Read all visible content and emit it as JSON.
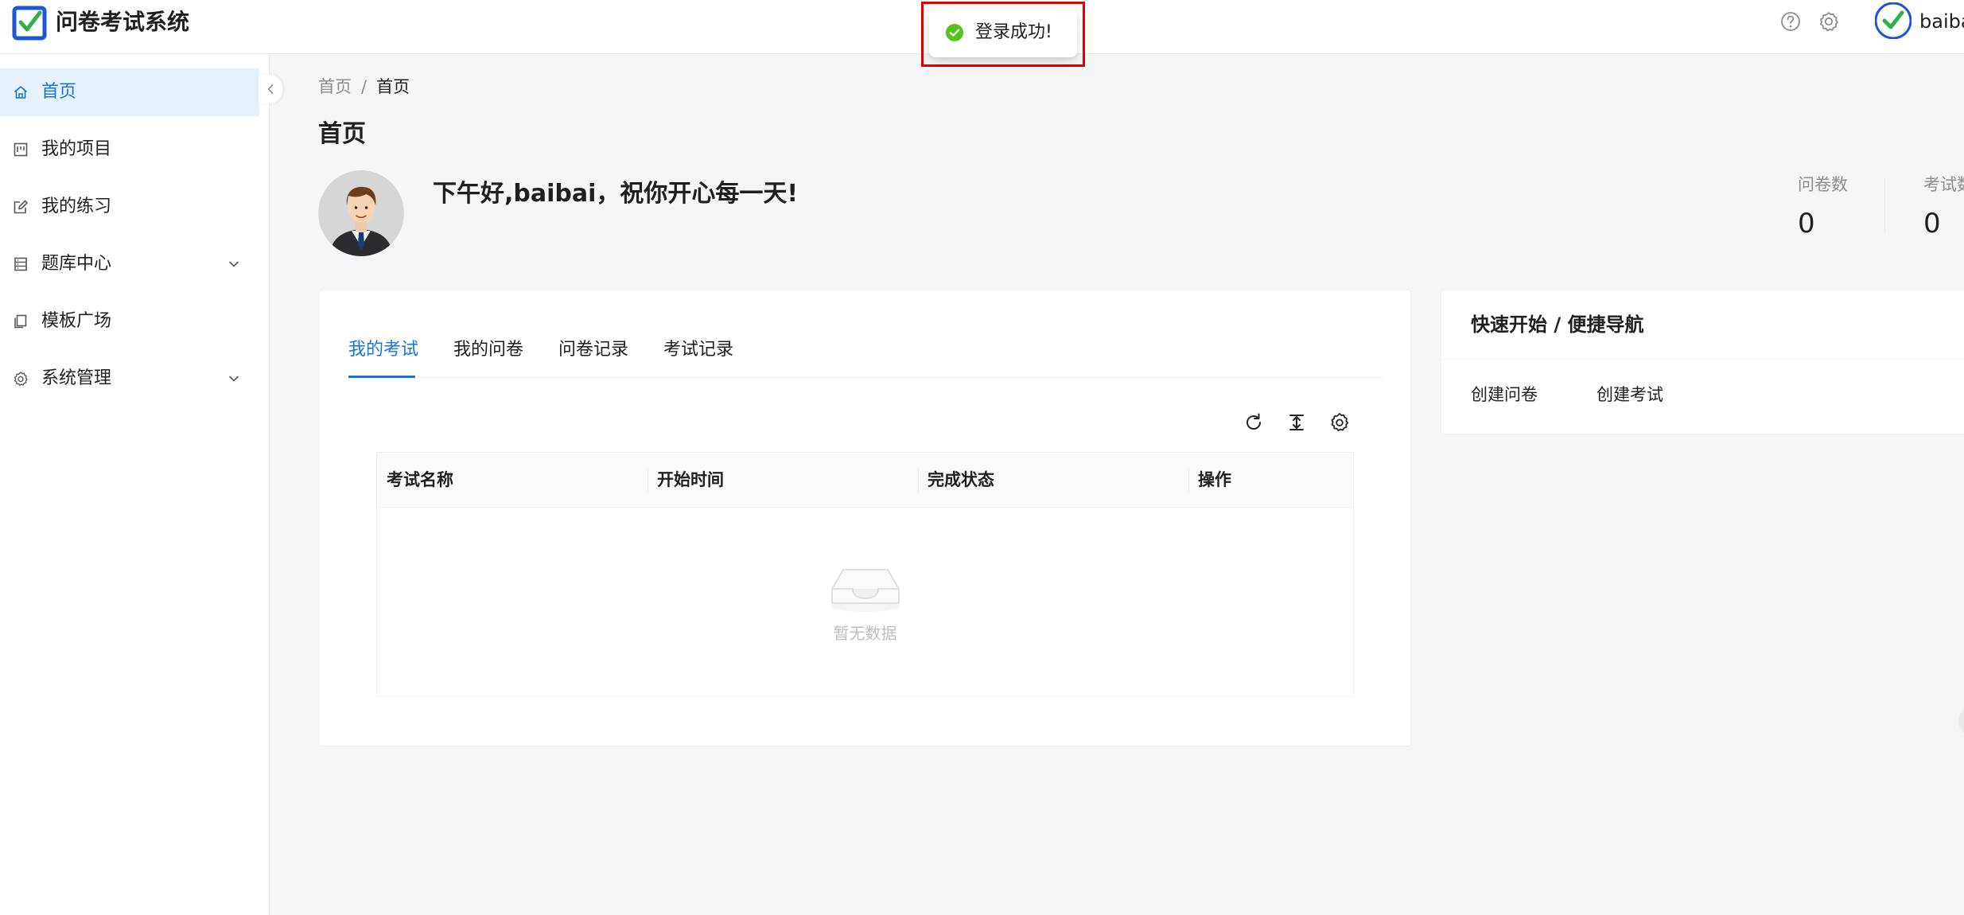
{
  "header": {
    "app_title": "问卷考试系统",
    "logo_icon": "check-square-logo",
    "help_icon": "question-circle-icon",
    "settings_icon": "gear-icon",
    "user_name": "baibai"
  },
  "toast": {
    "message": "登录成功!",
    "icon": "check-circle-icon",
    "icon_color": "#52c41a",
    "highlight_color": "#e00000"
  },
  "sidebar": {
    "items": [
      {
        "label": "首页",
        "icon": "home-icon",
        "active": true
      },
      {
        "label": "我的项目",
        "icon": "project-icon",
        "active": false
      },
      {
        "label": "我的练习",
        "icon": "edit-icon",
        "active": false
      },
      {
        "label": "题库中心",
        "icon": "database-icon",
        "active": false,
        "expandable": true
      },
      {
        "label": "模板广场",
        "icon": "copy-icon",
        "active": false
      },
      {
        "label": "系统管理",
        "icon": "setting-icon",
        "active": false,
        "expandable": true
      }
    ]
  },
  "breadcrumb": {
    "items": [
      "首页",
      "首页"
    ],
    "separator": "/"
  },
  "page_title": "首页",
  "profile": {
    "greeting": "下午好,baibai，祝你开心每一天!"
  },
  "stats": [
    {
      "label": "问卷数",
      "value": "0"
    },
    {
      "label": "考试数",
      "value": "0"
    }
  ],
  "exam_card": {
    "tabs": [
      {
        "label": "我的考试",
        "active": true
      },
      {
        "label": "我的问卷",
        "active": false
      },
      {
        "label": "问卷记录",
        "active": false
      },
      {
        "label": "考试记录",
        "active": false
      }
    ],
    "toolbar_icons": [
      "reload-icon",
      "column-height-icon",
      "setting-icon"
    ],
    "table": {
      "columns": [
        "考试名称",
        "开始时间",
        "完成状态",
        "操作"
      ],
      "rows": [],
      "empty_text": "暂无数据"
    }
  },
  "quick_card": {
    "title": "快速开始 / 便捷导航",
    "links": [
      "创建问卷",
      "创建考试"
    ]
  },
  "colors": {
    "accent": "#1677d2",
    "active_bg": "#e6f1fc",
    "page_bg": "#f5f6f8"
  }
}
